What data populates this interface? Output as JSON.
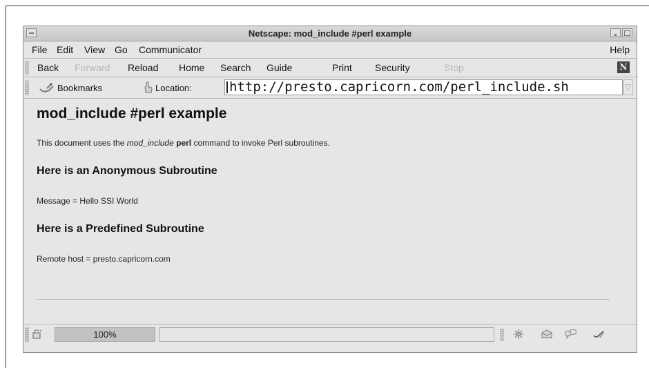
{
  "window": {
    "title": "Netscape: mod_include #perl example"
  },
  "menubar": {
    "items": [
      "File",
      "Edit",
      "View",
      "Go",
      "Communicator"
    ],
    "help": "Help"
  },
  "toolbar": {
    "buttons": [
      {
        "label": "Back",
        "enabled": true
      },
      {
        "label": "Forward",
        "enabled": false
      },
      {
        "label": "Reload",
        "enabled": true
      },
      {
        "label": "Home",
        "enabled": true
      },
      {
        "label": "Search",
        "enabled": true
      },
      {
        "label": "Guide",
        "enabled": true
      },
      {
        "label": "Print",
        "enabled": true
      },
      {
        "label": "Security",
        "enabled": true
      },
      {
        "label": "Stop",
        "enabled": false
      }
    ],
    "logo_glyph": "N"
  },
  "location_bar": {
    "bookmarks_label": "Bookmarks",
    "location_label": "Location:",
    "url": "http://presto.capricorn.com/perl_include.sh",
    "dropdown_glyph": "▽"
  },
  "content": {
    "heading": "mod_include #perl example",
    "intro": {
      "before": "This document uses the ",
      "italic": "mod_include",
      "space": " ",
      "bold": "perl",
      "after": " command to invoke Perl subroutines."
    },
    "section1": {
      "heading": "Here is an Anonymous Subroutine",
      "text": "Message = Hello SSI World"
    },
    "section2": {
      "heading": "Here is a Predefined Subroutine",
      "text": "Remote host = presto.capricorn.com"
    }
  },
  "statusbar": {
    "progress_label": "100%",
    "progress_fraction": 1.0,
    "status_text": "",
    "icons": [
      "component-icon",
      "mail-icon",
      "discussion-icon",
      "composer-icon"
    ]
  }
}
